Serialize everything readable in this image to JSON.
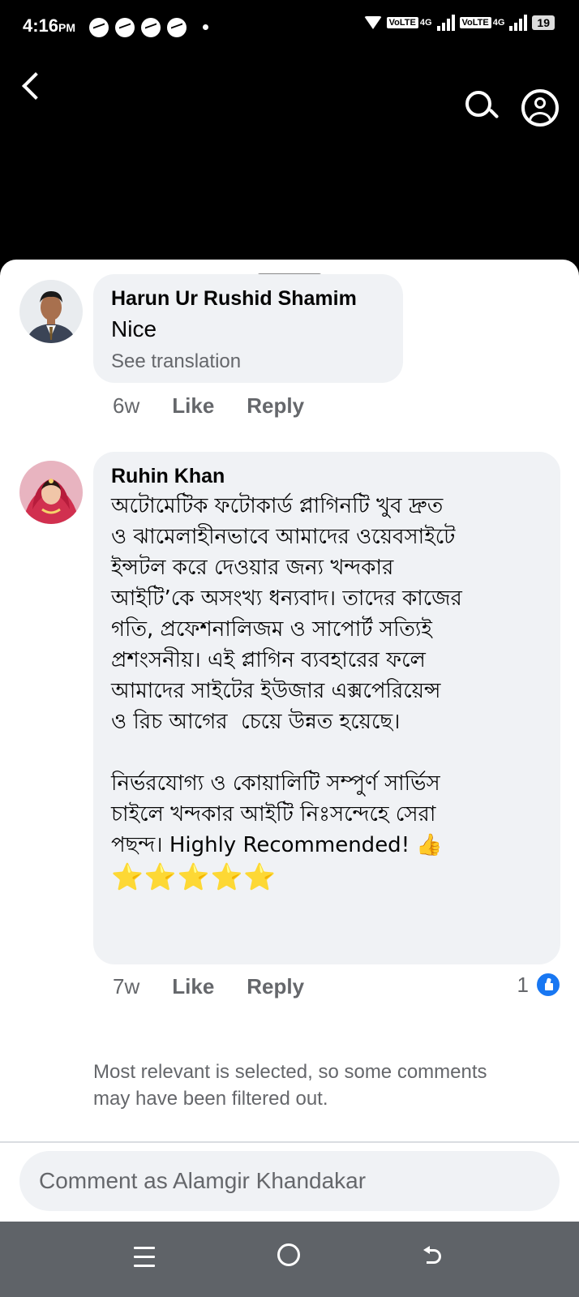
{
  "status_bar": {
    "time": "4:16",
    "ampm": "PM",
    "network1": "VoLTE",
    "net_type1": "4G",
    "network2": "VoLTE",
    "net_type2": "4G",
    "battery": "19"
  },
  "header": {
    "back_icon": "chevron-left-icon",
    "search_icon": "search-icon",
    "profile_icon": "user-circle-icon"
  },
  "comments": [
    {
      "author": "Harun Ur Rushid Shamim",
      "text": "Nice",
      "see_translation": "See translation",
      "time": "6w",
      "like_label": "Like",
      "reply_label": "Reply"
    },
    {
      "author": "Ruhin Khan",
      "text": "অটোমেটিক ফটোকার্ড প্লাগিনটি খুব দ্রুত\nও ঝামেলাহীনভাবে আমাদের ওয়েবসাইটে\nইন্সটল করে দেওয়ার জন্য খন্দকার\nআইটি’কে অসংখ্য ধন্যবাদ। তাদের কাজের\nগতি, প্রফেশনালিজম ও সাপোর্ট সত্যিই\nপ্রশংসনীয়। এই প্লাগিন ব্যবহারের ফলে\nআমাদের সাইটের ইউজার এক্সপেরিয়েন্স\nও রিচ আগের  চেয়ে উন্নত হয়েছে।\n\nনির্ভরযোগ্য ও কোয়ালিটি সম্পুর্ণ সার্ভিস\nচাইলে খন্দকার আইটি নিঃসন্দেহে সেরা\nপছন্দ। Highly Recommended! 👍",
      "stars": "⭐⭐⭐⭐⭐",
      "time": "7w",
      "like_label": "Like",
      "reply_label": "Reply",
      "reaction_count": "1"
    }
  ],
  "filter_note": "Most relevant is selected, so some comments may have been filtered out.",
  "comment_input": {
    "placeholder": "Comment as Alamgir Khandakar"
  },
  "colors": {
    "accent": "#1877f2",
    "bubble": "#f0f2f5",
    "secondary_text": "#65676b"
  }
}
